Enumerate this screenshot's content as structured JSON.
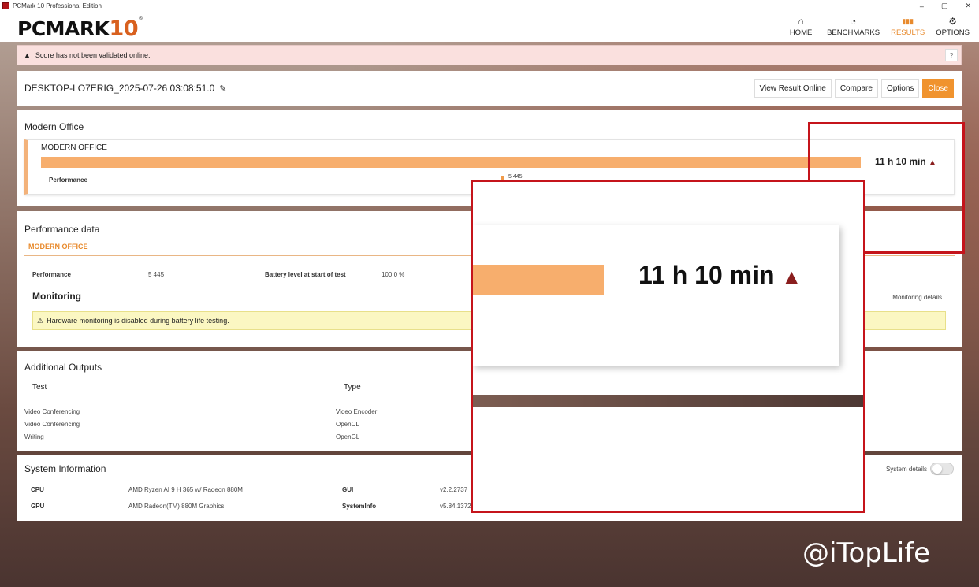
{
  "window": {
    "title": "PCMark 10 Professional Edition",
    "controls": [
      "–",
      "▢",
      "✕"
    ]
  },
  "header": {
    "logo_main": "PCMARK",
    "logo_num": "10",
    "logo_reg": "®",
    "nav": [
      {
        "label": "HOME",
        "icon": "⌂"
      },
      {
        "label": "BENCHMARKS",
        "icon": "◔"
      },
      {
        "label": "RESULTS",
        "icon": "▮▮▮"
      },
      {
        "label": "OPTIONS",
        "icon": "⚙"
      }
    ]
  },
  "alert": {
    "text": "Score has not been validated online.",
    "help": "?"
  },
  "result": {
    "name": "DESKTOP-LO7ERIG_2025-07-26 03:08:51.0",
    "edit_icon": "✎",
    "actions": {
      "view_online": "View Result Online",
      "compare": "Compare",
      "options": "Options",
      "close": "Close"
    }
  },
  "modern_office": {
    "section_title": "Modern Office",
    "card_title": "MODERN OFFICE",
    "result": "11 h 10 min",
    "warn_icon": "▲",
    "performance_label": "Performance",
    "performance_value": "5 445"
  },
  "performance_data": {
    "title": "Performance data",
    "tab": "MODERN OFFICE",
    "perf_label": "Performance",
    "perf_value": "5 445",
    "battery_label": "Battery level at start of test",
    "battery_value": "100.0 %",
    "monitoring_title": "Monitoring",
    "monitoring_details": "Monitoring details",
    "monitoring_warning": "Hardware monitoring is disabled during battery life testing."
  },
  "additional_outputs": {
    "title": "Additional Outputs",
    "columns": {
      "test": "Test",
      "type": "Type"
    },
    "rows": [
      {
        "test": "Video Conferencing",
        "type": "Video Encoder"
      },
      {
        "test": "Video Conferencing",
        "type": "OpenCL"
      },
      {
        "test": "Writing",
        "type": "OpenGL"
      }
    ]
  },
  "system_info": {
    "title": "System Information",
    "details_label": "System details",
    "cpu_label": "CPU",
    "cpu_value": "AMD Ryzen AI 9 H 365 w/ Radeon 880M",
    "gpu_label": "GPU",
    "gpu_value": "AMD Radeon(TM) 880M Graphics",
    "gui_label": "GUI",
    "gui_value": "v2.2.2737",
    "sysinfo_label": "SystemInfo",
    "sysinfo_value": "v5.84.1372"
  },
  "zoom": {
    "result": "11 h 10 min",
    "warn_icon": "▲"
  },
  "watermark": "@iTopLife"
}
